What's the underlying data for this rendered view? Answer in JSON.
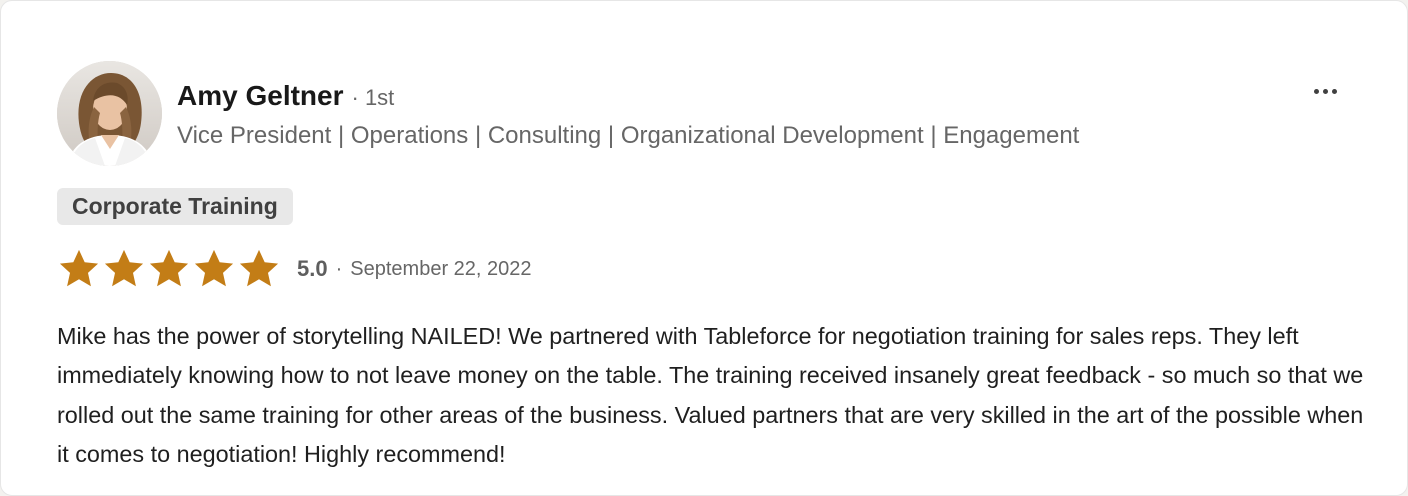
{
  "reviewer": {
    "name": "Amy Geltner",
    "degree": "· 1st",
    "headline": "Vice President | Operations | Consulting | Organizational Development | Engagement"
  },
  "tag": "Corporate Training",
  "rating": {
    "value": 5.0,
    "max": 5,
    "score_label": "5.0",
    "separator": "·",
    "date": "September 22, 2022",
    "star_color": "#c37d16"
  },
  "review_text": "Mike has the power of storytelling NAILED! We partnered with Tableforce for negotiation training for sales reps. They left immediately knowing how to not leave money on the table. The training received insanely great feedback - so much so that we rolled out the same training for other areas of the business. Valued partners that are very skilled in the art of the possible when it comes to negotiation! Highly recommend!",
  "icons": {
    "more": "more-horizontal-icon",
    "star": "star-icon"
  }
}
